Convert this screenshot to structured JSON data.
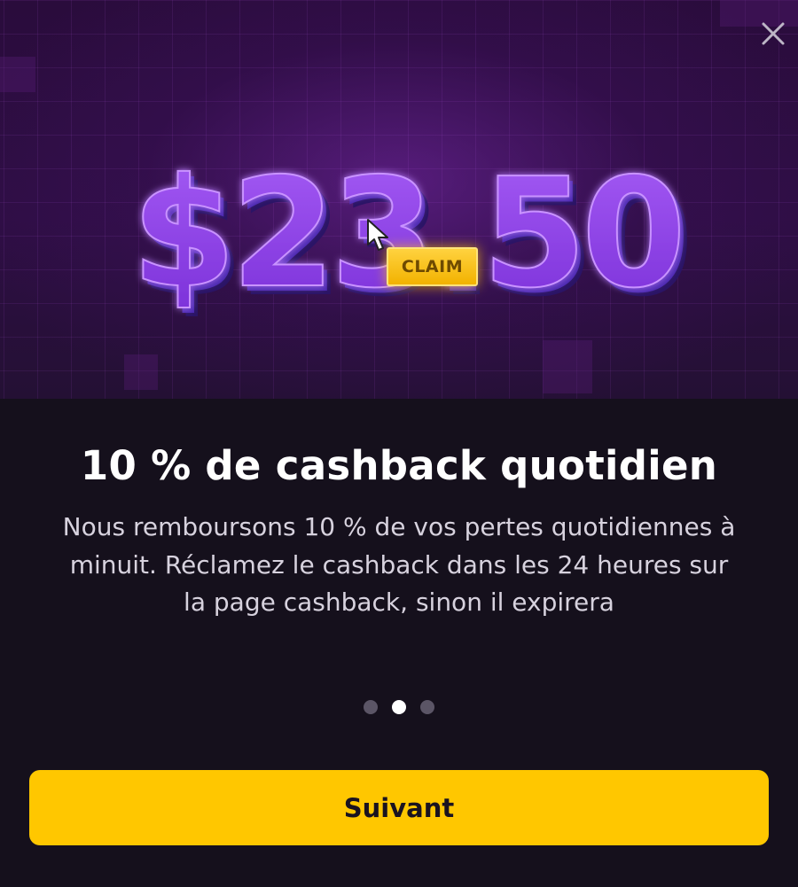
{
  "modal": {
    "close_icon": "close-icon",
    "hero": {
      "amount_text": "$23.50",
      "claim_label": "CLAIM",
      "cursor_icon": "cursor-arrow-icon",
      "colors": {
        "amount_front": "#8a3fe6",
        "amount_dark": "#3a1fa0",
        "claim_bg": "#ffc700"
      }
    },
    "title": "10 % de cashback quotidien",
    "description": "Nous remboursons 10 % de vos pertes quotidiennes à minuit. Réclamez le cashback dans les 24 heures sur la page cashback, sinon il expirera",
    "pagination": {
      "total": 3,
      "active_index": 1
    },
    "next_button": {
      "label": "Suivant",
      "color": "#ffc700"
    }
  }
}
